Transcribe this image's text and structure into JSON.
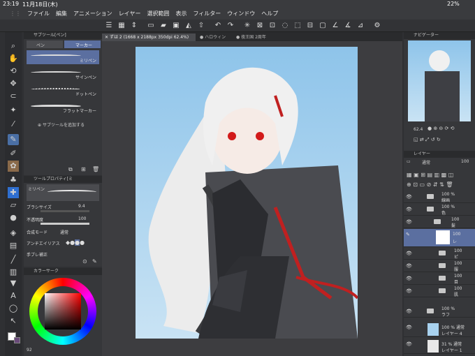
{
  "status": {
    "time": "23:19",
    "date": "11月18日(木)",
    "battery": "22%"
  },
  "menu": [
    "ファイル",
    "編集",
    "アニメーション",
    "レイヤー",
    "選択範囲",
    "表示",
    "フィルター",
    "ウィンドウ",
    "ヘルプ"
  ],
  "subtool": {
    "title": "サブツール[ペン]",
    "tab_pen": "ペン",
    "tab_marker": "マーカー",
    "brushes": [
      "ミリペン",
      "サインペン",
      "ドットペン",
      "フラットマーカー"
    ],
    "add": "サブツールを追加する"
  },
  "toolprop": {
    "title": "ツールプロパティ[ミ",
    "preview": "ミリペン",
    "brush_size_label": "ブラシサイズ",
    "brush_size": "9.4",
    "opacity_label": "不透明度",
    "opacity": "100",
    "blend_label": "合成モード",
    "blend": "通常",
    "aa_label": "アンチエイリアス",
    "stabil_label": "手ブレ補正"
  },
  "color": {
    "title": "カラーサーク",
    "value": "92"
  },
  "tabs": [
    "ずは 2 (1668 x 2188px 350dpi 62.4%)",
    "ハロウィン",
    "夜王国 2周年"
  ],
  "navigator": {
    "title": "ナビゲーター",
    "zoom": "62.4"
  },
  "layers": {
    "title": "レイヤー",
    "blend": "通常",
    "opacity": "100",
    "rows": [
      {
        "l1": "100 %",
        "l2": "線画"
      },
      {
        "l1": "100 %",
        "l2": "色"
      },
      {
        "l1": "100",
        "l2": "髪"
      },
      {
        "l1": "100",
        "l2": "レ"
      },
      {
        "l1": "100",
        "l2": "ピ"
      },
      {
        "l1": "100",
        "l2": "服"
      },
      {
        "l1": "100",
        "l2": "目"
      },
      {
        "l1": "100",
        "l2": "肌"
      },
      {
        "l1": "100 %",
        "l2": "ラフ"
      },
      {
        "l1": "100 % 通常",
        "l2": "レイヤー 4"
      },
      {
        "l1": "31 % 通常",
        "l2": "レイヤー 1"
      }
    ]
  }
}
